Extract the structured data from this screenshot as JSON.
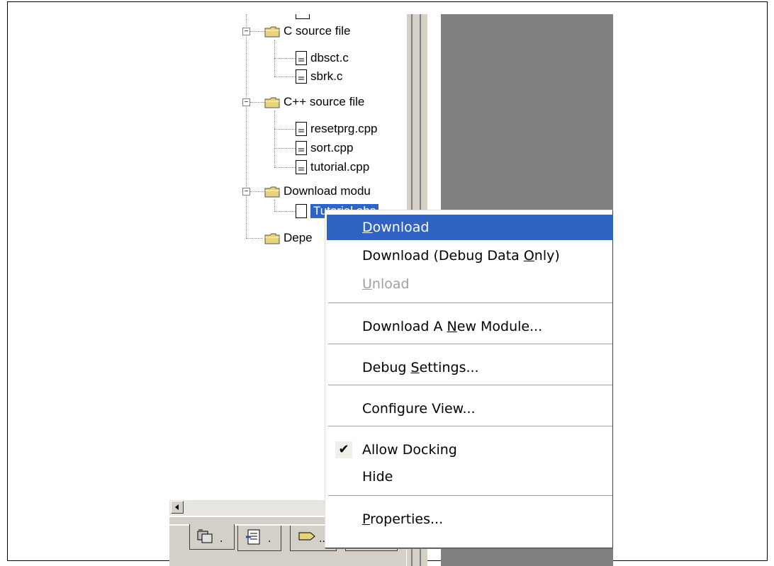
{
  "tree": {
    "groups": [
      {
        "label": "C source file",
        "files": [
          "dbsct.c",
          "sbrk.c"
        ]
      },
      {
        "label": "C++ source file",
        "files": [
          "resetprg.cpp",
          "sort.cpp",
          "tutorial.cpp"
        ]
      },
      {
        "label": "Download modu",
        "files": [
          "Tutorial.abs"
        ]
      },
      {
        "label": "Depe",
        "files": []
      }
    ],
    "selected_label": "Tutorial.abs"
  },
  "context_menu": {
    "items": [
      {
        "pre": "",
        "key": "D",
        "post": "ownload",
        "state": "highlighted"
      },
      {
        "pre": "Download (Debug Data ",
        "key": "O",
        "post": "nly)",
        "state": "normal"
      },
      {
        "pre": "",
        "key": "U",
        "post": "nload",
        "state": "disabled"
      },
      {
        "pre": "Download A ",
        "key": "N",
        "post": "ew Module...",
        "state": "normal"
      },
      {
        "pre": "Debug ",
        "key": "S",
        "post": "ettings...",
        "state": "normal"
      },
      {
        "pre": "Configure View...",
        "key": "",
        "post": "",
        "state": "normal"
      },
      {
        "pre": "Allow Docking",
        "key": "",
        "post": "",
        "state": "checked"
      },
      {
        "pre": "Hide",
        "key": "",
        "post": "",
        "state": "normal"
      },
      {
        "pre": "",
        "key": "P",
        "post": "roperties...",
        "state": "normal"
      }
    ]
  },
  "tabs": [
    {
      "icon": "project-icon",
      "suffix": "."
    },
    {
      "icon": "navigation-icon",
      "suffix": "."
    },
    {
      "icon": "label-icon",
      "suffix": ".."
    },
    {
      "icon": "test-icon",
      "suffix": ".."
    }
  ],
  "colors": {
    "highlight": "#3163c5",
    "folder": "#e8d27a",
    "panel": "#d4d0c8",
    "workspace": "#808080"
  }
}
